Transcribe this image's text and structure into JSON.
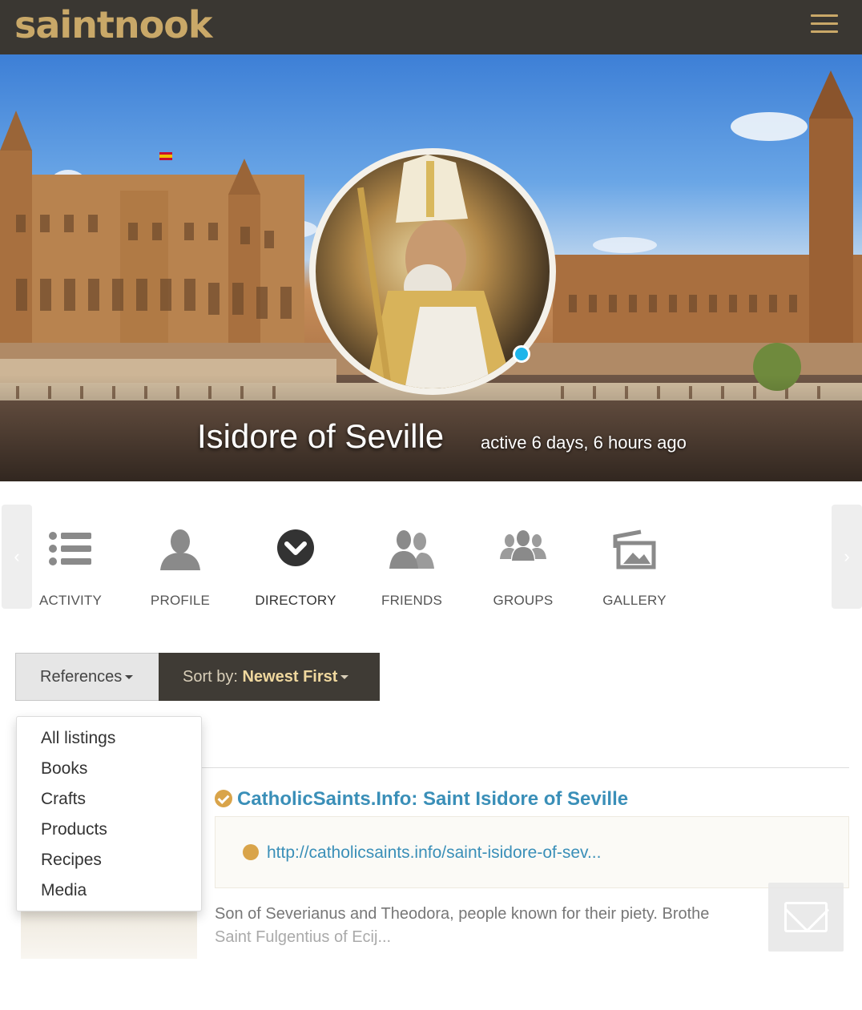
{
  "app": {
    "logo_text": "saintnook"
  },
  "header": {
    "menu_icon": "hamburger-menu-icon"
  },
  "cover": {
    "name": "Isidore of Seville",
    "last_active": "active 6 days, 6 hours ago",
    "online_color": "#1fb5ea"
  },
  "tabs": [
    {
      "label": "ACTIVITY",
      "icon": "list-icon"
    },
    {
      "label": "PROFILE",
      "icon": "person-icon"
    },
    {
      "label": "DIRECTORY",
      "icon": "chevron-circle-icon"
    },
    {
      "label": "FRIENDS",
      "icon": "friends-icon"
    },
    {
      "label": "GROUPS",
      "icon": "groups-icon"
    },
    {
      "label": "GALLERY",
      "icon": "gallery-icon"
    }
  ],
  "filters": {
    "category_label": "References",
    "sort_prefix": "Sort by:",
    "sort_value": "Newest First"
  },
  "dropdown": {
    "items": [
      "All listings",
      "Books",
      "Crafts",
      "Products",
      "Recipes",
      "Media"
    ]
  },
  "listing": {
    "title": "CatholicSaints.Info: Saint Isidore of Seville",
    "url": "http://catholicsaints.info/saint-isidore-of-sev...",
    "excerpt_line1": "Son of Severianus and Theodora, people known for their piety. Brothe",
    "excerpt_line2": "Saint Fulgentius of Ecij..."
  },
  "colors": {
    "header_bg": "#3a3732",
    "brand_gold": "#c9a868",
    "link_blue": "#3a8fb8",
    "accent_gold": "#d9a44a"
  }
}
